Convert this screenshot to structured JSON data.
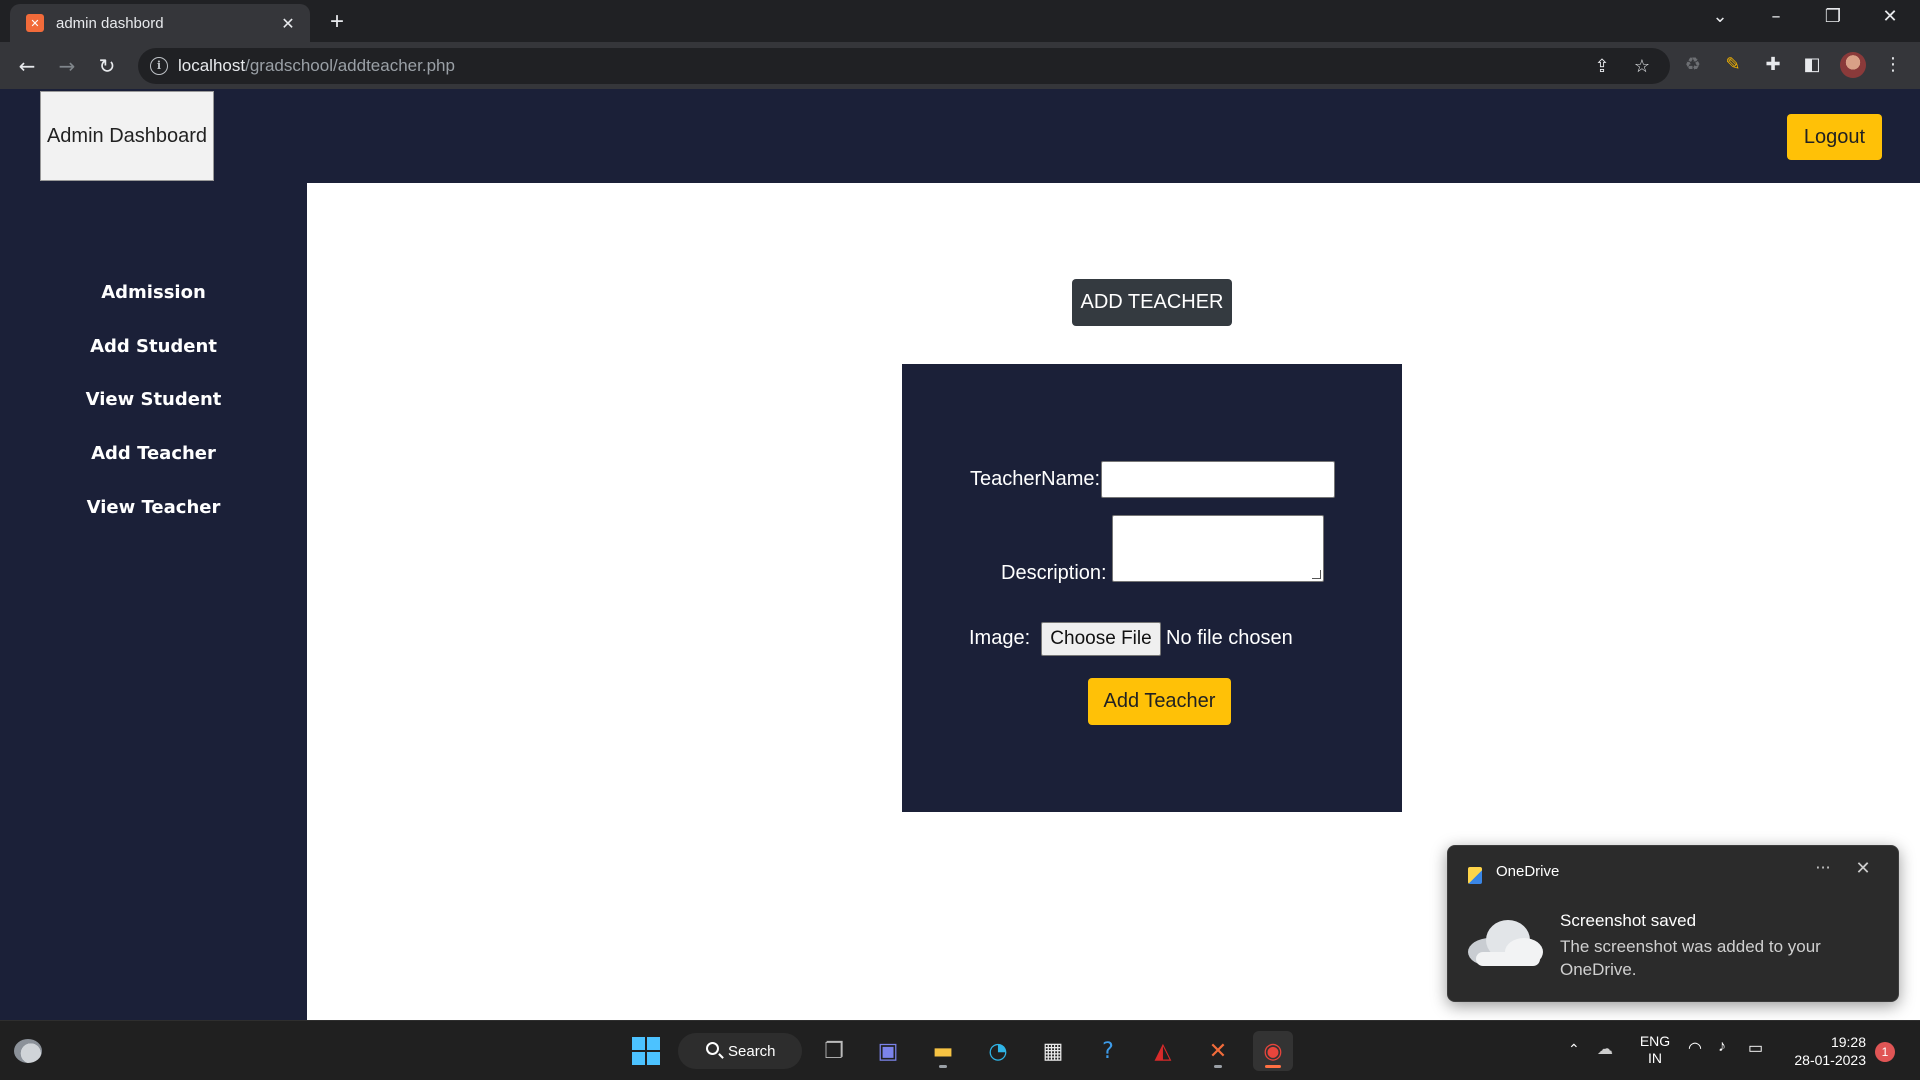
{
  "browser": {
    "tab_title": "admin dashbord",
    "url_host": "localhost",
    "url_path": "/gradschool/addteacher.php"
  },
  "header": {
    "brand": "Admin Dashboard",
    "logout_label": "Logout"
  },
  "sidebar": {
    "items": [
      {
        "label": "Admission"
      },
      {
        "label": "Add Student"
      },
      {
        "label": "View Student"
      },
      {
        "label": "Add Teacher"
      },
      {
        "label": "View Teacher"
      }
    ]
  },
  "main": {
    "heading": "ADD TEACHER",
    "form": {
      "teacher_name_label": "TeacherName:",
      "teacher_name_value": "",
      "description_label": "Description:",
      "description_value": "",
      "image_label": "Image:",
      "choose_file_label": "Choose File",
      "file_status": "No file chosen",
      "submit_label": "Add Teacher"
    }
  },
  "toast": {
    "app": "OneDrive",
    "title": "Screenshot saved",
    "body": "The screenshot was added to your OneDrive."
  },
  "taskbar": {
    "search_label": "Search",
    "lang_line1": "ENG",
    "lang_line2": "IN",
    "time": "19:28",
    "date": "28-01-2023",
    "notification_count": "1"
  },
  "colors": {
    "navy": "#1b2038",
    "accent_yellow": "#ffc107",
    "heading_dark": "#343a40"
  }
}
